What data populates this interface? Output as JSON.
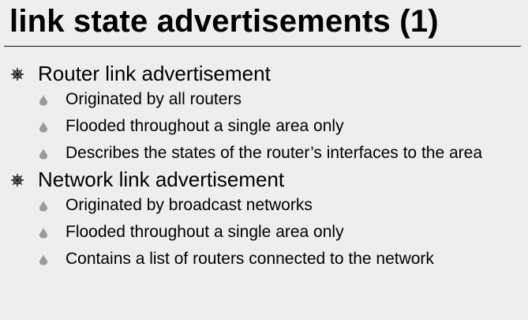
{
  "slide": {
    "title": "link state advertisements (1)",
    "sections": [
      {
        "heading": "Router link advertisement",
        "bullets": [
          "Originated by all routers",
          "Flooded throughout a single area only",
          "Describes the states of the router’s interfaces to the area"
        ]
      },
      {
        "heading": "Network link advertisement",
        "bullets": [
          "Originated by broadcast networks",
          "Flooded throughout a single area only",
          "Contains a list of routers connected to the network"
        ]
      }
    ]
  },
  "icons": {
    "level1_bullet": "ships-wheel-icon",
    "level2_bullet": "drop-icon"
  },
  "colors": {
    "background": "#eeeeee",
    "text": "#000000",
    "rule": "#111111",
    "wheel_bullet": "#222222",
    "drop_bullet": "#9a9a9a"
  }
}
